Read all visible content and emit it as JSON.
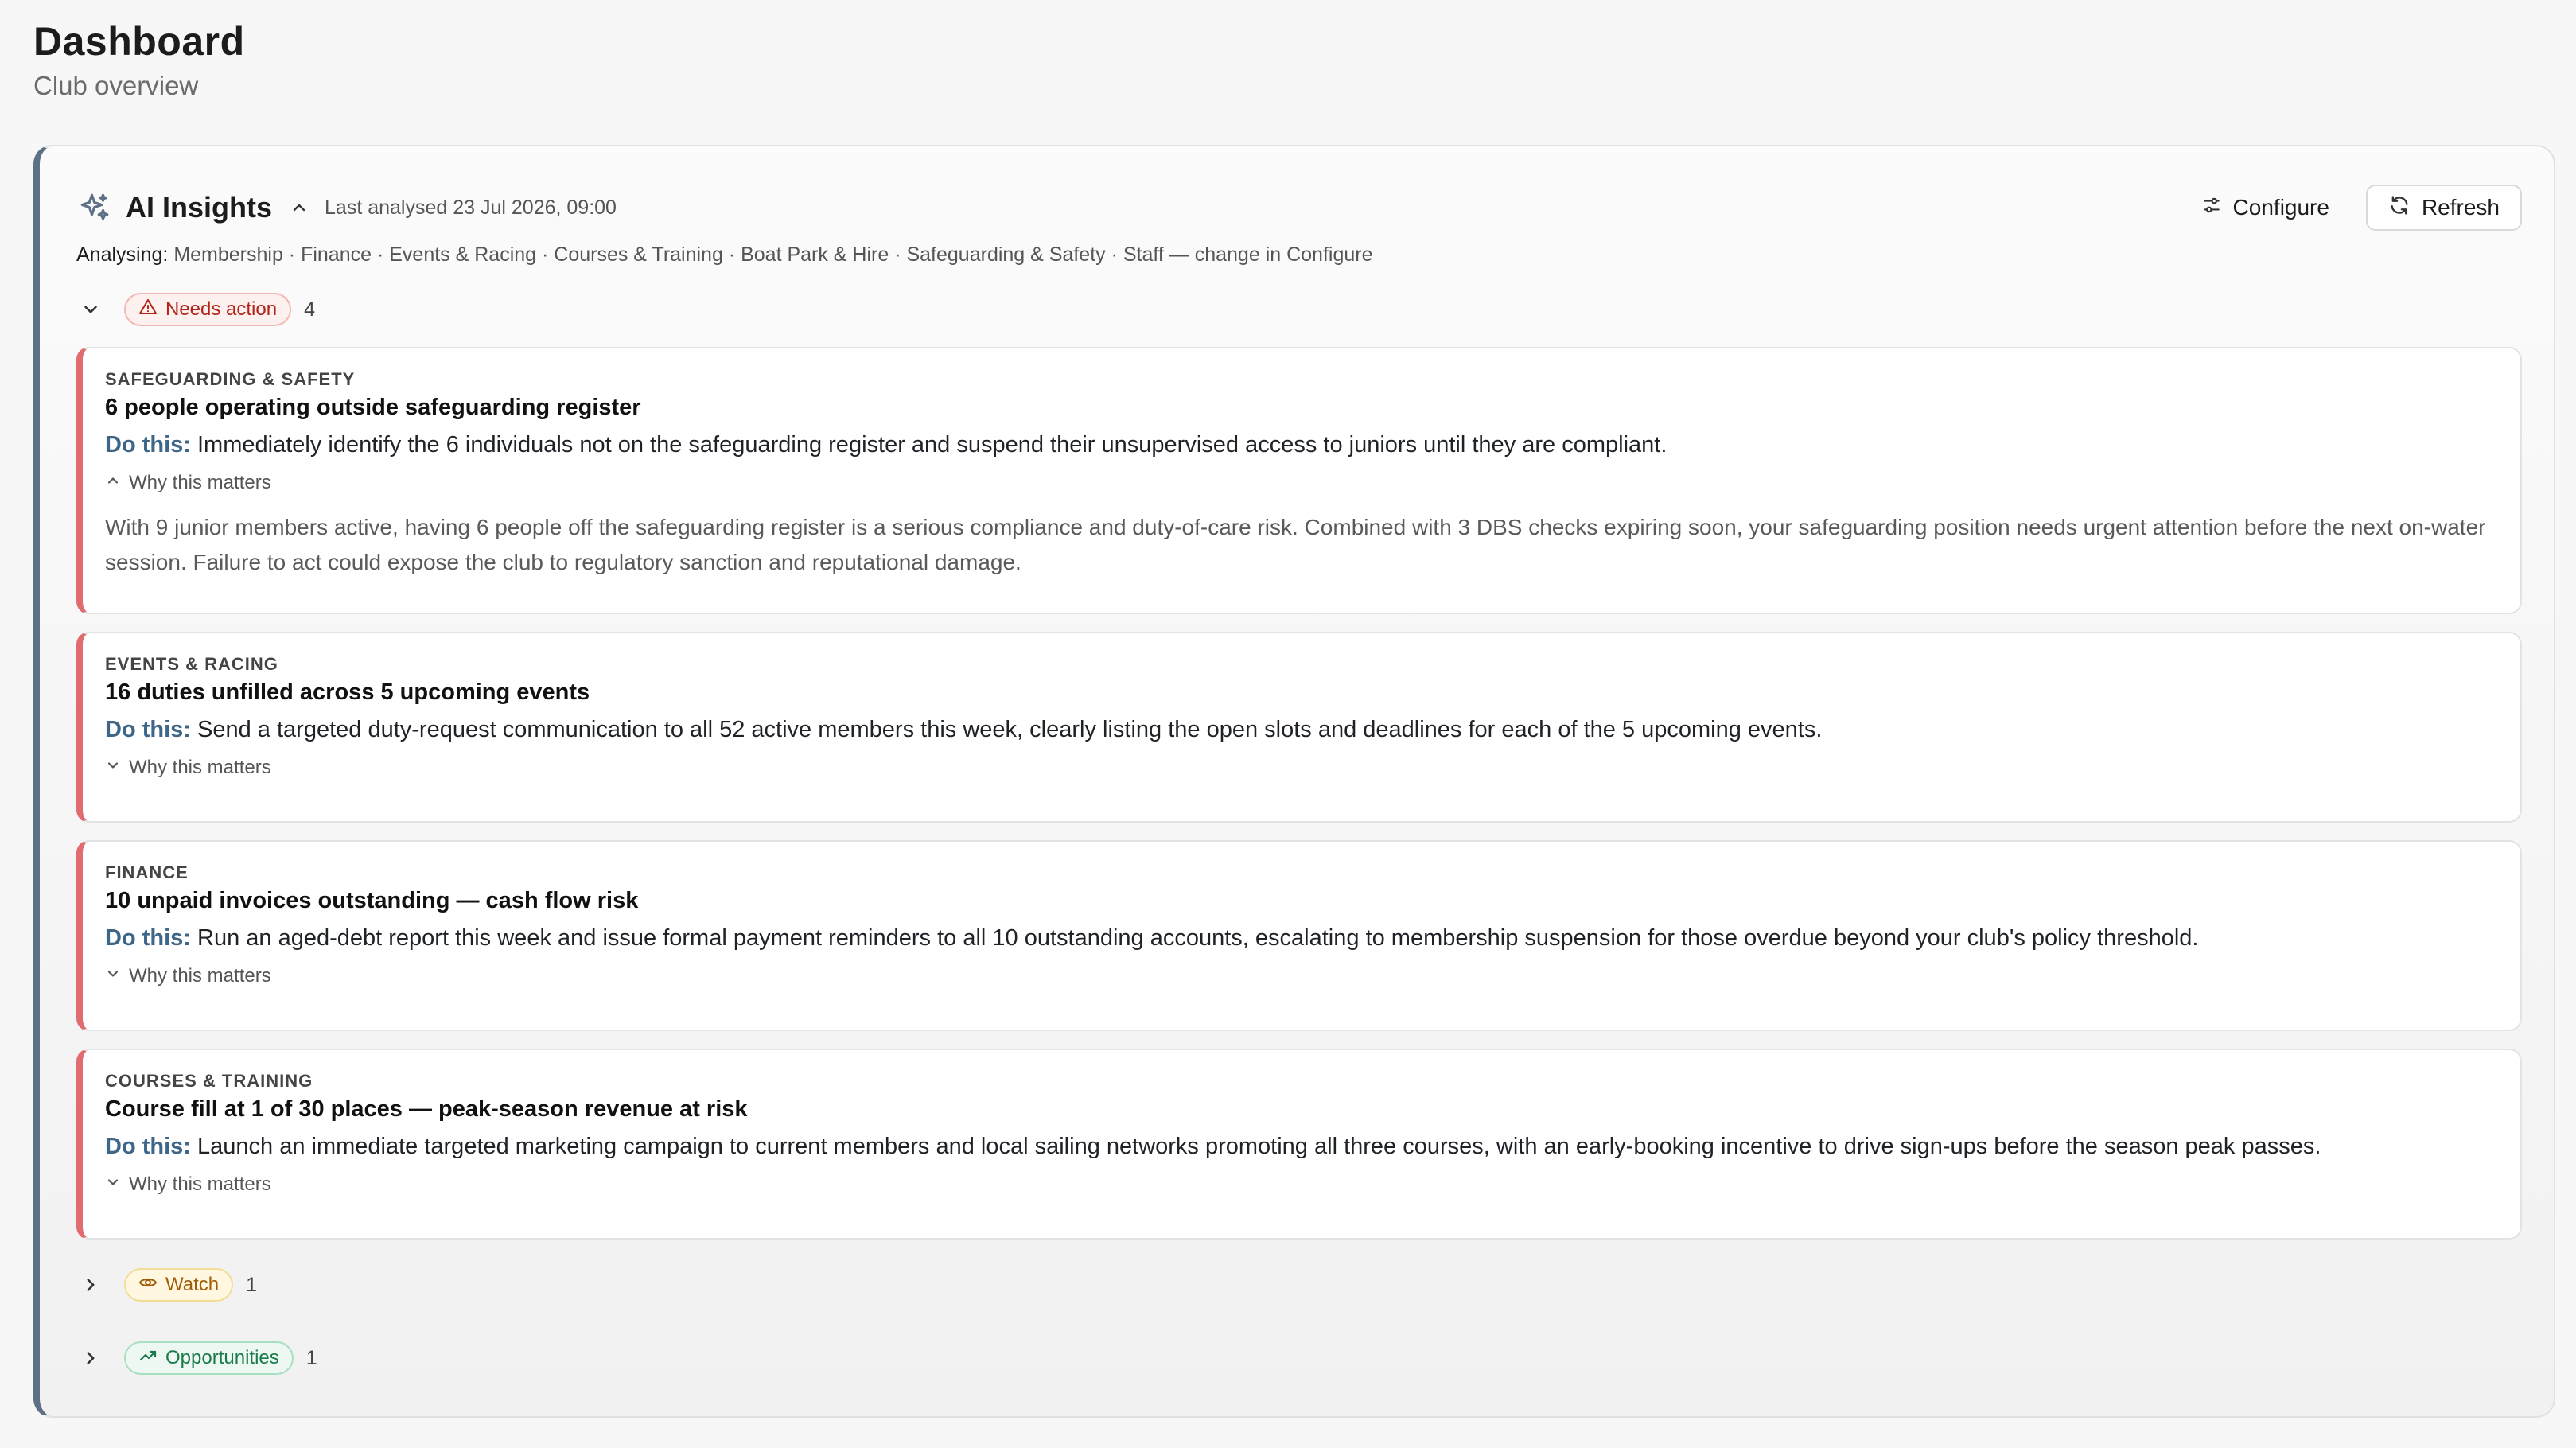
{
  "header": {
    "title": "Dashboard",
    "subtitle": "Club overview"
  },
  "insights": {
    "title": "AI Insights",
    "last_analysed": "Last analysed 23 Jul 2026, 09:00",
    "configure_label": "Configure",
    "refresh_label": "Refresh",
    "analysing_label": "Analysing:",
    "analysing_text": "Membership · Finance · Events & Racing · Courses & Training · Boat Park & Hire · Safeguarding & Safety · Staff — change in Configure"
  },
  "groups": {
    "needs_action": {
      "label": "Needs action",
      "count": "4",
      "color": "#b42318"
    },
    "watch": {
      "label": "Watch",
      "count": "1",
      "color": "#a15c07"
    },
    "opportunities": {
      "label": "Opportunities",
      "count": "1",
      "color": "#1b7a4a"
    }
  },
  "do_label": "Do this:",
  "why_label": "Why this matters",
  "cards": [
    {
      "category": "SAFEGUARDING & SAFETY",
      "title": "6 people operating outside safeguarding register",
      "action": "Immediately identify the 6 individuals not on the safeguarding register and suspend their unsupervised access to juniors until they are compliant.",
      "why": "With 9 junior members active, having 6 people off the safeguarding register is a serious compliance and duty-of-care risk. Combined with 3 DBS checks expiring soon, your safeguarding position needs urgent attention before the next on-water session. Failure to act could expose the club to regulatory sanction and reputational damage."
    },
    {
      "category": "EVENTS & RACING",
      "title": "16 duties unfilled across 5 upcoming events",
      "action": "Send a targeted duty-request communication to all 52 active members this week, clearly listing the open slots and deadlines for each of the 5 upcoming events."
    },
    {
      "category": "FINANCE",
      "title": "10 unpaid invoices outstanding — cash flow risk",
      "action": "Run an aged-debt report this week and issue formal payment reminders to all 10 outstanding accounts, escalating to membership suspension for those overdue beyond your club's policy threshold."
    },
    {
      "category": "COURSES & TRAINING",
      "title": "Course fill at 1 of 30 places — peak-season revenue at risk",
      "action": "Launch an immediate targeted marketing campaign to current members and local sailing networks promoting all three courses, with an early-booking incentive to drive sign-ups before the season peak passes."
    }
  ]
}
